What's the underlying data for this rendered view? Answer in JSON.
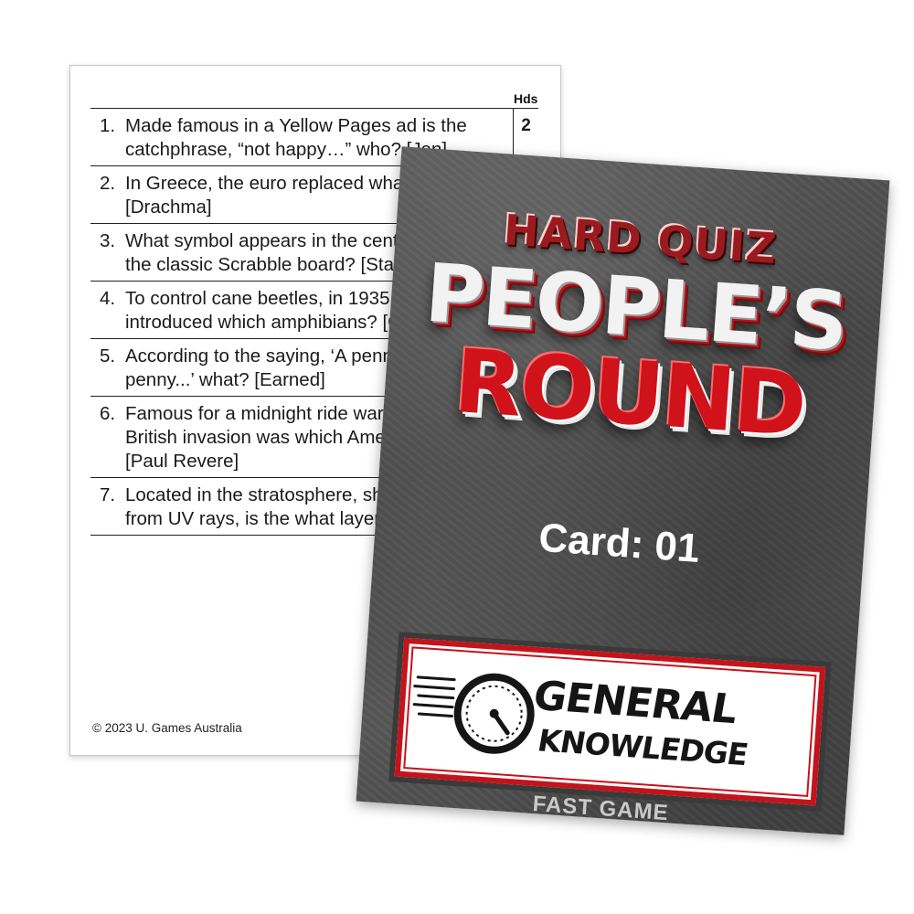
{
  "question_card": {
    "hds_header": "Hds",
    "rows": [
      {
        "num": "1.",
        "text": "Made famous in a Yellow Pages ad is the catchphrase, “not happy…” who? [Jan]",
        "hds": "2"
      },
      {
        "num": "2.",
        "text": "In Greece, the euro replaced what currency? [Drachma]",
        "hds": ""
      },
      {
        "num": "3.",
        "text": "What symbol appears in the centre square of the classic Scrabble board? [Star]",
        "hds": ""
      },
      {
        "num": "4.",
        "text": "To control cane beetles, in 1935 Queensland introduced which amphibians? [Cane toads]",
        "hds": ""
      },
      {
        "num": "5.",
        "text": "According to the saying, ‘A penny saved is a penny...’ what? [Earned]",
        "hds": ""
      },
      {
        "num": "6.",
        "text": "Famous for a midnight ride warning of a British invasion was which American hero? [Paul Revere]",
        "hds": ""
      },
      {
        "num": "7.",
        "text": "Located in the stratosphere, shielding Earth from UV rays, is the what layer? [Ozone]",
        "hds": ""
      }
    ],
    "copyright": "© 2023 U. Games Australia"
  },
  "front_card": {
    "title_top": "HARD QUIZ",
    "title_mid": "PEOPLE’S",
    "title_bottom": "ROUND",
    "card_label": "Card: 01",
    "category_line1": "GENERAL",
    "category_line2": "KNOWLEDGE",
    "category_icon": "speedometer-icon",
    "game_mode": "FAST GAME"
  },
  "colors": {
    "accent_red": "#c3141c",
    "card_grey": "#4f4f4f"
  }
}
